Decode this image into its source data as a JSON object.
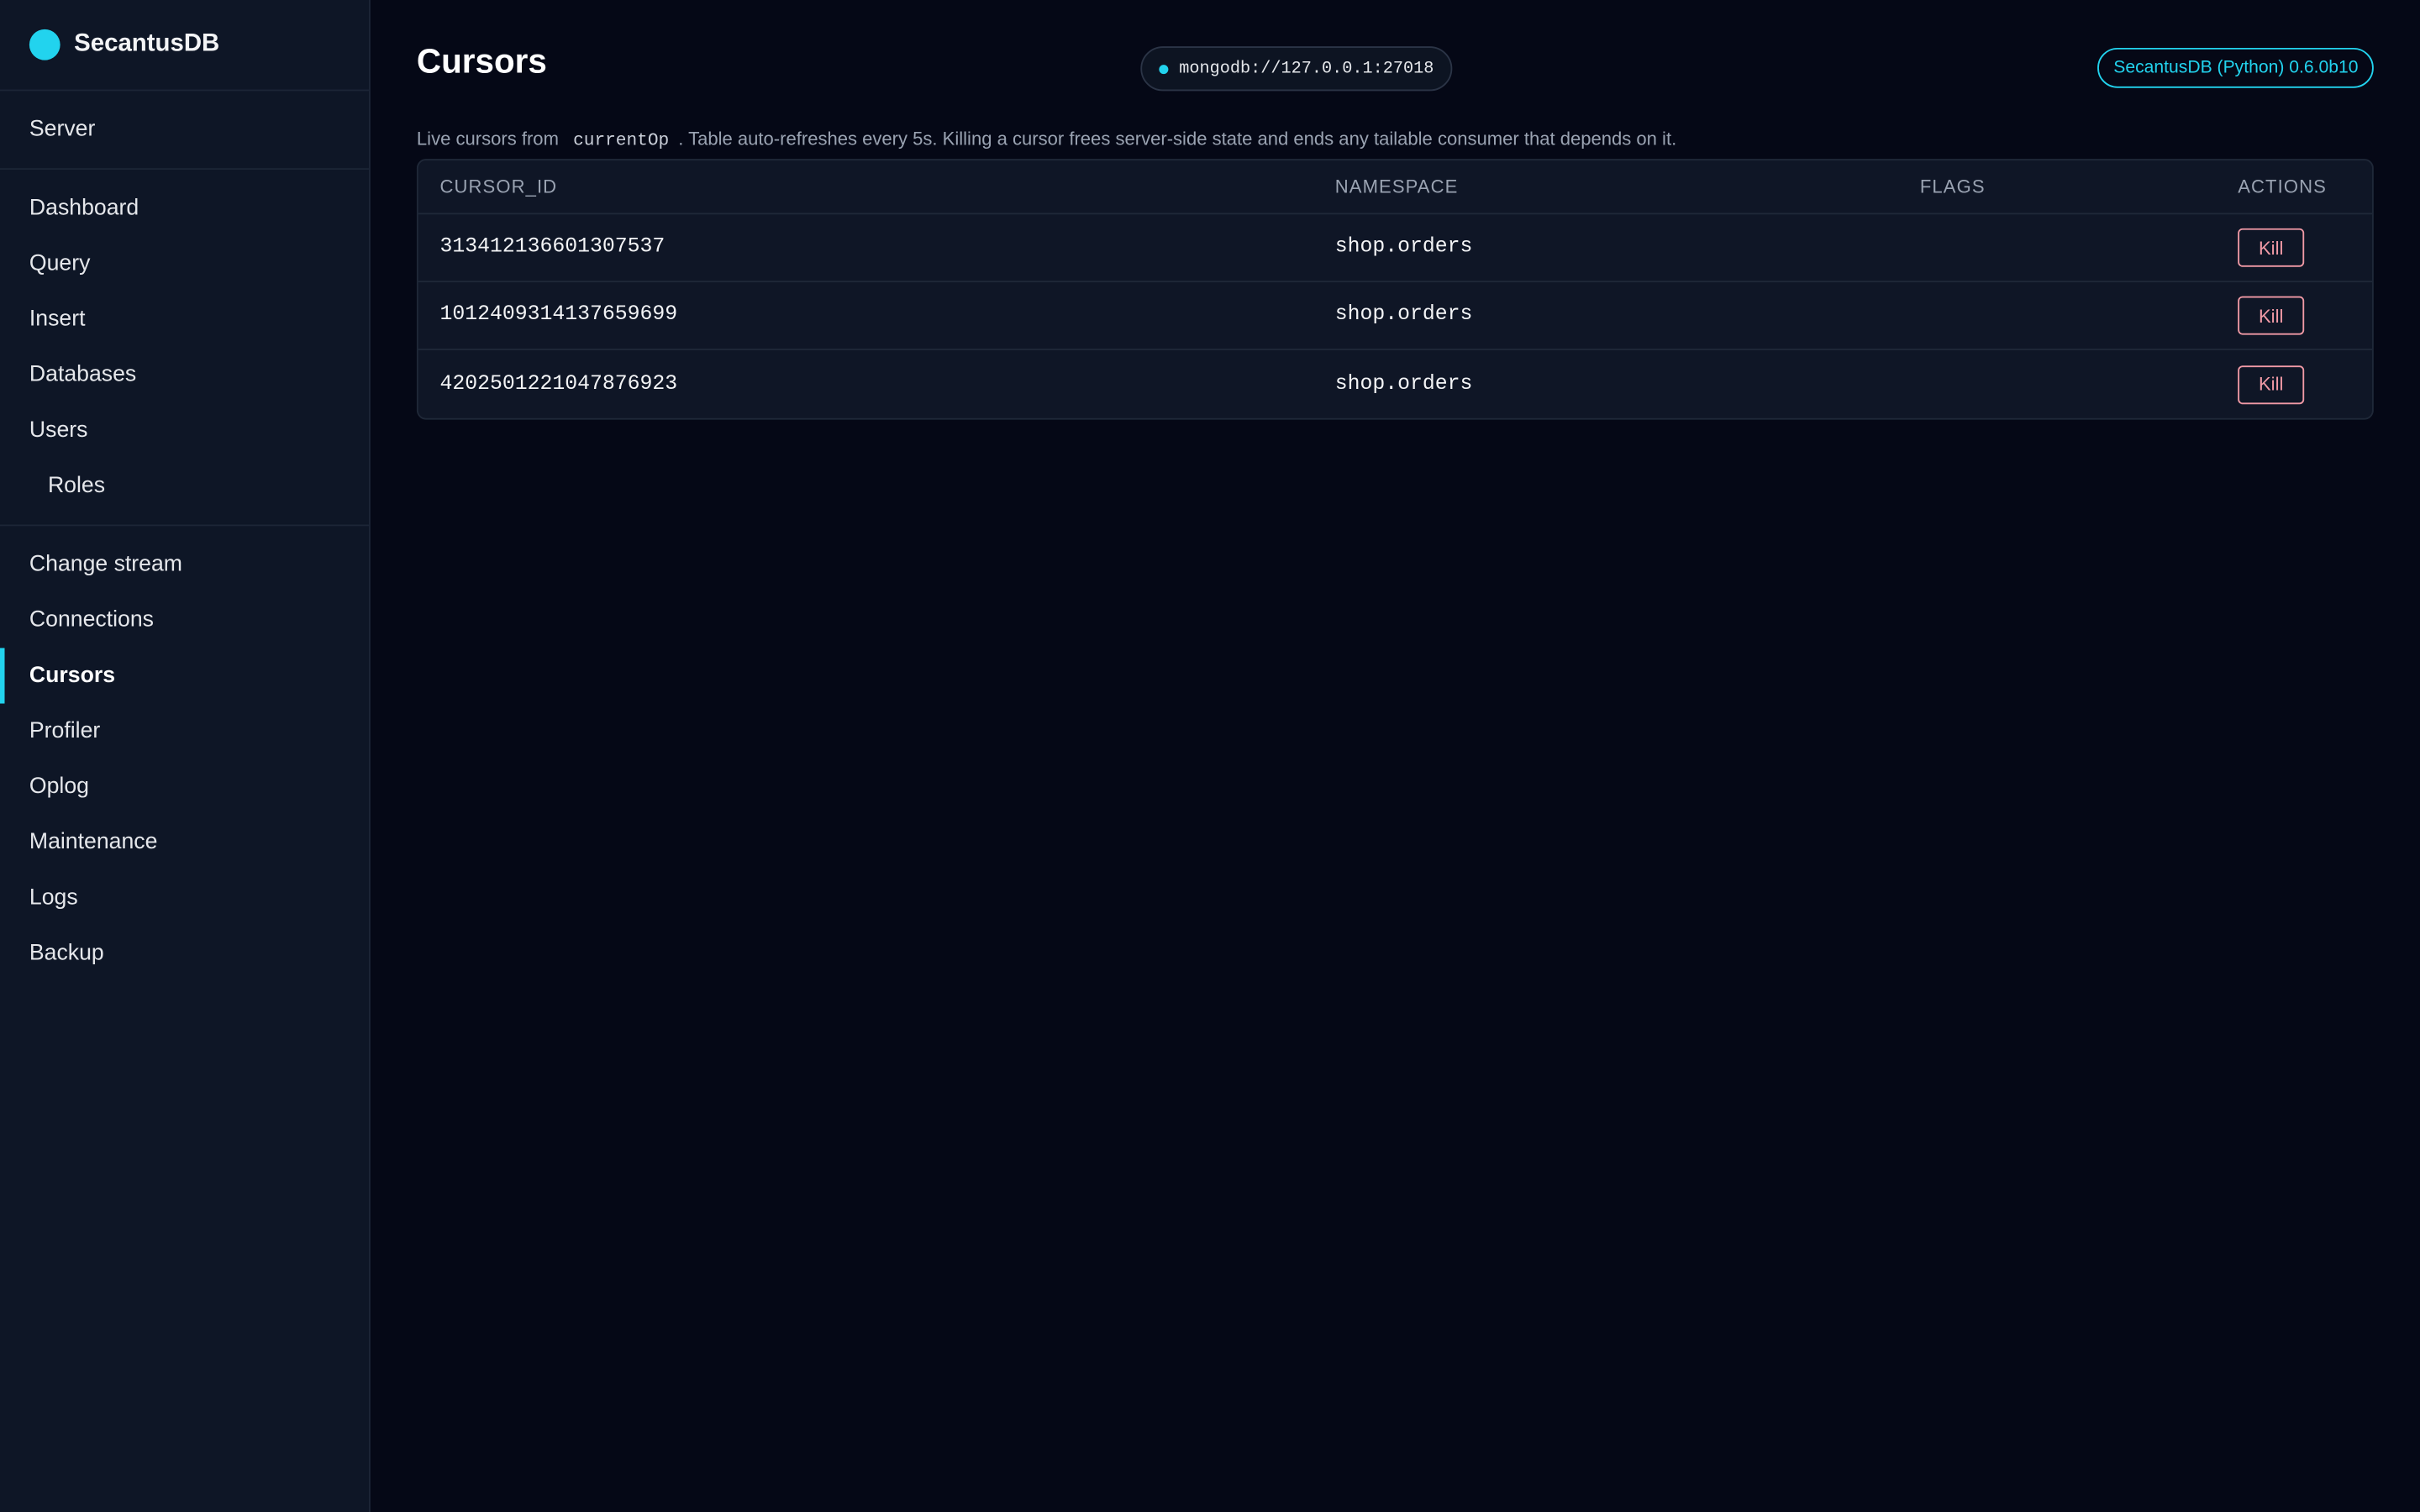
{
  "brand": {
    "name": "SecantusDB"
  },
  "sidebar": {
    "groups": [
      {
        "items": [
          {
            "label": "Server"
          }
        ]
      },
      {
        "items": [
          {
            "label": "Dashboard"
          },
          {
            "label": "Query"
          },
          {
            "label": "Insert"
          },
          {
            "label": "Databases"
          },
          {
            "label": "Users"
          },
          {
            "label": "Roles"
          }
        ]
      },
      {
        "items": [
          {
            "label": "Change stream"
          },
          {
            "label": "Connections"
          },
          {
            "label": "Cursors"
          },
          {
            "label": "Profiler"
          },
          {
            "label": "Oplog"
          },
          {
            "label": "Maintenance"
          },
          {
            "label": "Logs"
          },
          {
            "label": "Backup"
          }
        ]
      }
    ]
  },
  "header": {
    "title": "Cursors",
    "connection": "mongodb://127.0.0.1:27018",
    "version": "SecantusDB (Python) 0.6.0b10"
  },
  "description": {
    "prefix": "Live cursors from",
    "code": "currentOp",
    "suffix": ". Table auto-refreshes every 5s. Killing a cursor frees server-side state and ends any tailable consumer that depends on it."
  },
  "table": {
    "columns": [
      "CURSOR_ID",
      "NAMESPACE",
      "FLAGS",
      "ACTIONS"
    ],
    "rows": [
      {
        "cursor_id": "313412136601307537",
        "namespace": "shop.orders",
        "flags": "",
        "action": "Kill"
      },
      {
        "cursor_id": "1012409314137659699",
        "namespace": "shop.orders",
        "flags": "",
        "action": "Kill"
      },
      {
        "cursor_id": "4202501221047876923",
        "namespace": "shop.orders",
        "flags": "",
        "action": "Kill"
      }
    ]
  },
  "colors": {
    "accent": "#22d3ee",
    "background": "#050816",
    "sidebar": "#0e1626",
    "danger": "#f19aa6"
  }
}
